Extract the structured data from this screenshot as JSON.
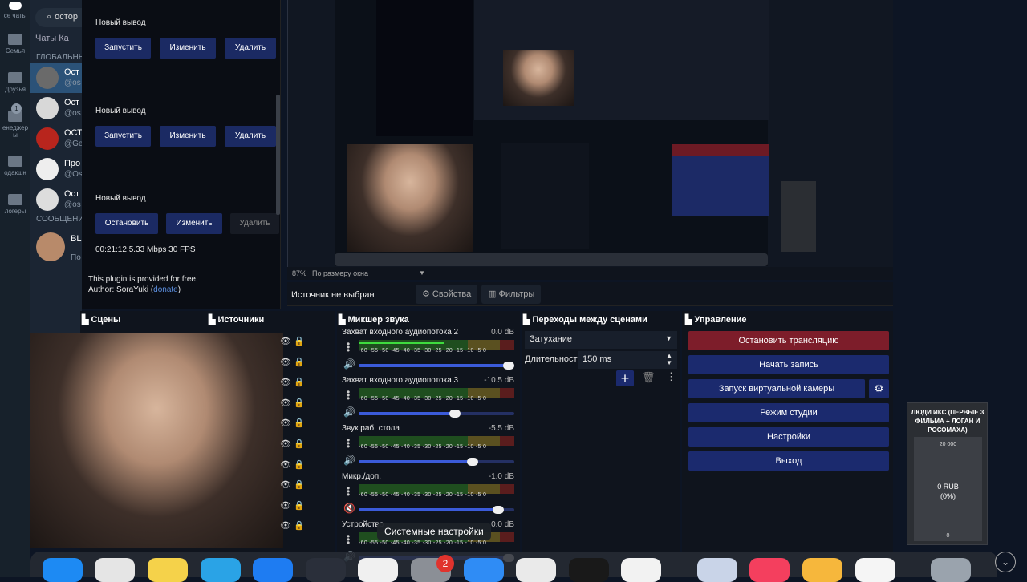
{
  "telegram": {
    "folders": [
      "се чаты",
      "Семья",
      "Друзья",
      "енеджер ы",
      "одакшн",
      "логеры"
    ],
    "unread_badge": "1",
    "search_value": "остор",
    "tabs": "Чаты   Ка",
    "section_global": "ГЛОБАЛЬНЫ",
    "section_messages": "СООБЩЕНИ",
    "chats": [
      {
        "name": "Ост",
        "user": "@os"
      },
      {
        "name": "Ост",
        "user": "@os"
      },
      {
        "name": "ОСТ",
        "user": "@Ge"
      },
      {
        "name": "Про",
        "user": "@Os"
      },
      {
        "name": "Ост",
        "user": "@os"
      },
      {
        "name": "BL",
        "user": "По"
      }
    ]
  },
  "plugin": {
    "outputs": [
      {
        "title": "Новый вывод",
        "start": "Запустить",
        "edit": "Изменить",
        "delete": "Удалить"
      },
      {
        "title": "Новый вывод",
        "start": "Запустить",
        "edit": "Изменить",
        "delete": "Удалить"
      },
      {
        "title": "Новый вывод",
        "start": "Остановить",
        "edit": "Изменить",
        "delete": "Удалить"
      }
    ],
    "stats": "00:21:12  5.33 Mbps  30 FPS",
    "note_line1": "This plugin is provided for free.",
    "note_author": "Author: SoraYuki (",
    "note_link": "donate",
    "note_end": ")"
  },
  "preview": {
    "zoom": "87%",
    "fit": "По размеру окна",
    "source_status": "Источник не выбран",
    "properties": "Свойства",
    "filters": "Фильтры"
  },
  "docks": {
    "scenes": "Сцены",
    "sources": "Источники",
    "mixer": "Микшер звука",
    "transitions": "Переходы между сценами",
    "controls": "Управление"
  },
  "mixer": {
    "scale": "-60  -55  -50  -45  -40  -35  -30  -25  -20  -15  -10   -5    0",
    "channels": [
      {
        "name": "Захват входного аудиопотока 2",
        "db": "0.0 dB",
        "volume": 1.0,
        "level": 0.55,
        "muted": false
      },
      {
        "name": "Захват входного аудиопотока 3",
        "db": "-10.5 dB",
        "volume": 0.63,
        "level": 0.0,
        "muted": false
      },
      {
        "name": "Звук раб. стола",
        "db": "-5.5 dB",
        "volume": 0.75,
        "level": 0.0,
        "muted": false
      },
      {
        "name": "Микр./доп.",
        "db": "-1.0 dB",
        "volume": 0.93,
        "level": 0.0,
        "muted": true
      },
      {
        "name": "Устройство",
        "db": "0.0 dB",
        "volume": 1.0,
        "level": 0.0,
        "muted": false
      }
    ]
  },
  "transitions": {
    "selected": "Затухание",
    "duration_label": "Длительность",
    "duration_value": "150 ms"
  },
  "controls": {
    "stop_stream": "Остановить трансляцию",
    "start_record": "Начать запись",
    "virtual_cam": "Запуск виртуальной камеры",
    "studio_mode": "Режим студии",
    "settings": "Настройки",
    "exit": "Выход"
  },
  "tooltip": "Системные настройки",
  "dock_badge": "2",
  "donation": {
    "title": "ЛЮДИ ИКС (ПЕРВЫЕ 3 ФИЛЬМА + ЛОГАН И РОСОМАХА)",
    "goal": "20 000",
    "amount": "0 RUB",
    "percent": "(0%)",
    "zero": "0"
  },
  "colors": {
    "stop_stream": "#7d1d2a",
    "control": "#1b2a6e",
    "accent_blue": "#3b5bd9"
  }
}
